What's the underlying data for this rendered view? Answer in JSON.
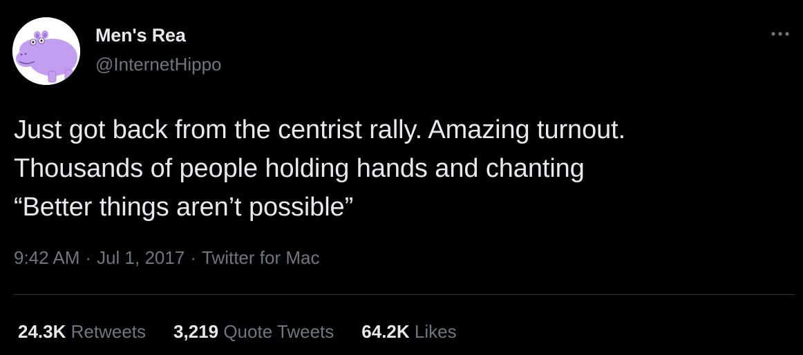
{
  "author": {
    "display_name": "Men's Rea",
    "handle": "@InternetHippo",
    "avatar_icon": "purple-hippo-avatar",
    "avatar_color": "#c39df0"
  },
  "menu": {
    "icon": "more-options-icon"
  },
  "tweet": {
    "lines": [
      "Just got back from the centrist rally. Amazing turnout.",
      "Thousands of people holding hands and chanting",
      "“Better things aren’t possible”"
    ]
  },
  "meta": {
    "time": "9:42 AM",
    "separator": "·",
    "date": "Jul 1, 2017",
    "source": "Twitter for Mac"
  },
  "stats": {
    "retweets": {
      "count": "24.3K",
      "label": "Retweets"
    },
    "quotes": {
      "count": "3,219",
      "label": "Quote Tweets"
    },
    "likes": {
      "count": "64.2K",
      "label": "Likes"
    }
  },
  "colors": {
    "background": "#000000",
    "primary_text": "#e7e9ea",
    "secondary_text": "#71767b",
    "divider": "#2f3336"
  }
}
